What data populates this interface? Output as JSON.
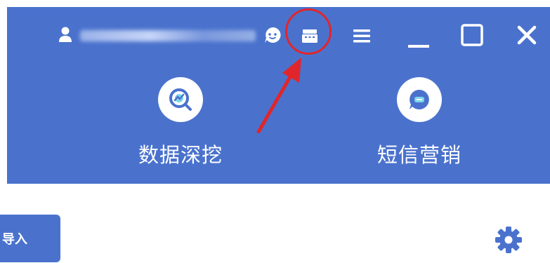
{
  "header": {
    "bg_color": "#4a72cd",
    "user": {
      "icon": "user-icon"
    },
    "toolbar": [
      {
        "icon": "chat-smiley-icon"
      },
      {
        "icon": "cabinet-icon",
        "highlighted": true
      },
      {
        "icon": "menu-icon"
      },
      {
        "icon": "minimize-icon"
      },
      {
        "icon": "maximize-icon"
      },
      {
        "icon": "close-icon"
      }
    ],
    "annotation": {
      "circle_color": "#e0262b",
      "arrow_color": "#e0262b"
    }
  },
  "features": [
    {
      "label": "数据深挖",
      "icon": "data-mining-icon"
    },
    {
      "label": "短信营销",
      "icon": "sms-marketing-icon"
    }
  ],
  "bottom": {
    "import_button": {
      "label": "导入"
    },
    "settings": {
      "icon": "gear-icon"
    }
  }
}
